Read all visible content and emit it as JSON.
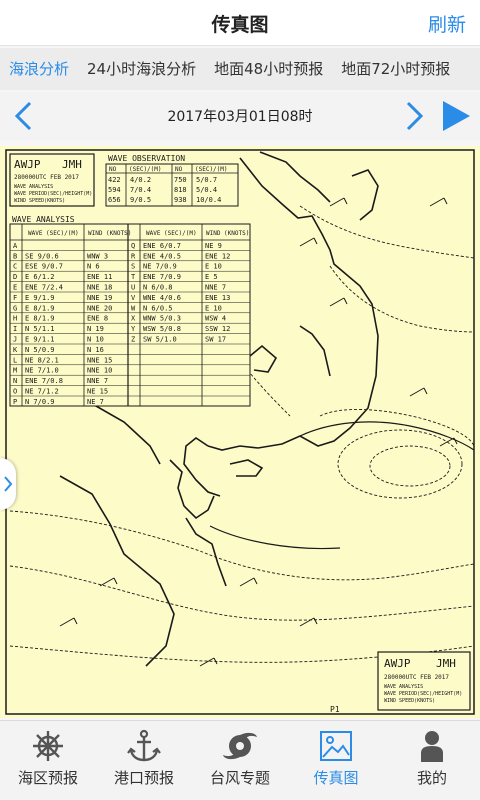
{
  "header": {
    "title": "传真图",
    "refresh_label": "刷新"
  },
  "tabs": [
    {
      "label": "海浪分析",
      "active": true
    },
    {
      "label": "24小时海浪分析",
      "active": false
    },
    {
      "label": "地面48小时预报",
      "active": false
    },
    {
      "label": "地面72小时预报",
      "active": false
    }
  ],
  "datebar": {
    "date": "2017年03月01日08时"
  },
  "chart": {
    "code": "AWJP",
    "agency": "JMH",
    "valid_time": "280000UTC FEB 2017",
    "subtitle_lines": [
      "WAVE ANALYSIS",
      "WAVE PERIOD(SEC)/HEIGHT(M)",
      "WIND SPEED(KNOTS)"
    ],
    "observation": {
      "title": "WAVE OBSERVATION",
      "headers": [
        "NO",
        "(SEC)/(M)",
        "NO",
        "(SEC)/(M)"
      ],
      "rows": [
        [
          "422",
          "4/0.2",
          "750",
          "5/0.7"
        ],
        [
          "594",
          "7/0.4",
          "818",
          "5/0.4"
        ],
        [
          "656",
          "9/0.5",
          "938",
          "10/0.4"
        ]
      ]
    },
    "analysis": {
      "title": "WAVE ANALYSIS",
      "headers": [
        "",
        "WAVE (SEC)/(M)",
        "WIND (KNOTS)",
        "",
        "WAVE (SEC)/(M)",
        "WIND (KNOTS)"
      ],
      "rows": [
        [
          "A",
          "",
          "",
          "Q",
          "ENE 6/0.7",
          "NE 9"
        ],
        [
          "B",
          "SE 9/0.6",
          "WNW 3",
          "R",
          "ENE 4/0.5",
          "ENE 12"
        ],
        [
          "C",
          "ESE 9/0.7",
          "N 6",
          "S",
          "NE 7/0.9",
          "E 10"
        ],
        [
          "D",
          "E 6/1.2",
          "ENE 11",
          "T",
          "ENE 7/0.9",
          "E 5"
        ],
        [
          "E",
          "ENE 7/2.4",
          "NNE 18",
          "U",
          "N 6/0.8",
          "NNE 7"
        ],
        [
          "F",
          "E 9/1.9",
          "NNE 19",
          "V",
          "WNE 4/0.6",
          "ENE 13"
        ],
        [
          "G",
          "E 8/1.9",
          "NNE 20",
          "W",
          "N 6/0.5",
          "E 10"
        ],
        [
          "H",
          "E 8/1.9",
          "ENE 8",
          "X",
          "WNW 5/0.3",
          "WSW 4"
        ],
        [
          "I",
          "N 5/1.1",
          "N 19",
          "Y",
          "WSW 5/0.8",
          "SSW 12"
        ],
        [
          "J",
          "E 9/1.1",
          "N 10",
          "Z",
          "SW 5/1.0",
          "SW 17"
        ],
        [
          "K",
          "N 5/0.9",
          "N 16",
          "",
          "",
          ""
        ],
        [
          "L",
          "NE 8/2.1",
          "NNE 15",
          "",
          "",
          ""
        ],
        [
          "M",
          "NE 7/1.0",
          "NNE 10",
          "",
          "",
          ""
        ],
        [
          "N",
          "ENE 7/0.8",
          "NNE 7",
          "",
          "",
          ""
        ],
        [
          "O",
          "NE 7/1.2",
          "NE 15",
          "",
          "",
          ""
        ],
        [
          "P",
          "N 7/0.9",
          "NE 7",
          "",
          "",
          ""
        ]
      ]
    },
    "corner_label": "P1"
  },
  "bottom_nav": [
    {
      "label": "海区预报",
      "icon": "ship-wheel-icon",
      "active": false
    },
    {
      "label": "港口预报",
      "icon": "anchor-icon",
      "active": false
    },
    {
      "label": "台风专题",
      "icon": "typhoon-icon",
      "active": false
    },
    {
      "label": "传真图",
      "icon": "image-icon",
      "active": true
    },
    {
      "label": "我的",
      "icon": "person-icon",
      "active": false
    }
  ],
  "colors": {
    "accent": "#2b8ce8",
    "chart_background": "#fdfbc8",
    "ink": "#1a1a1a"
  }
}
